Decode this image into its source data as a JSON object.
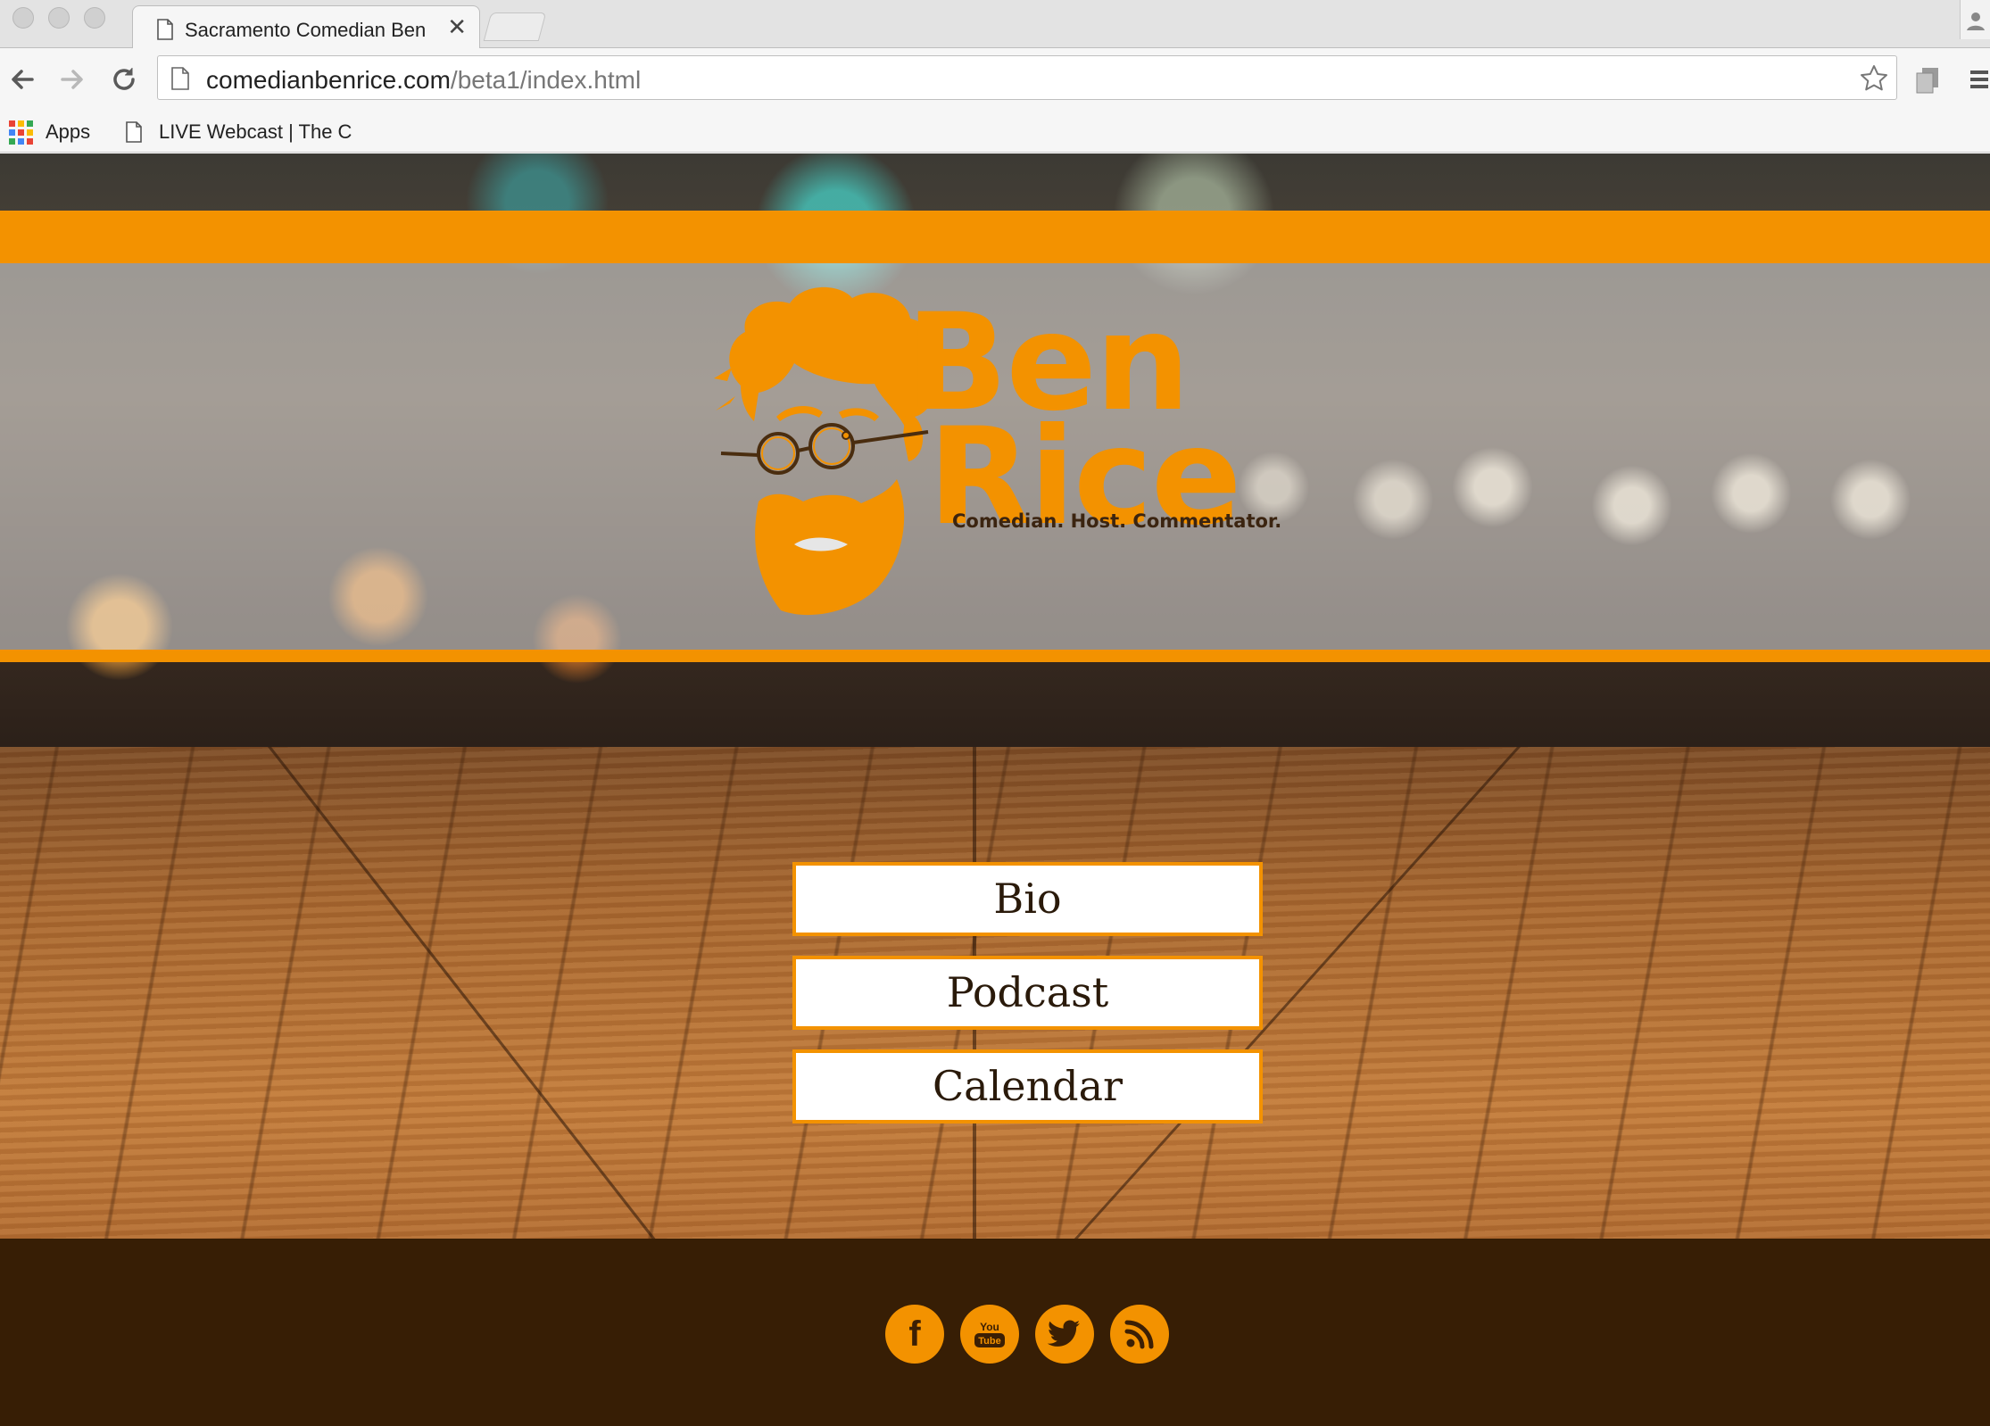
{
  "browser": {
    "tab": {
      "title": "Sacramento Comedian Ben",
      "close": "✕"
    },
    "address_bar": {
      "domain": "comedianbenrice.com",
      "path": "/beta1/index.html"
    },
    "bookmarks": [
      {
        "label": "Apps"
      },
      {
        "label": "LIVE Webcast | The C"
      }
    ]
  },
  "page": {
    "logo": {
      "first_name": "Ben",
      "last_name": "Rice",
      "tagline": "Comedian. Host. Commentator."
    },
    "nav": [
      {
        "label": "Bio"
      },
      {
        "label": "Podcast"
      },
      {
        "label": "Calendar"
      }
    ],
    "social": [
      {
        "icon": "facebook-icon",
        "glyph": "f"
      },
      {
        "icon": "youtube-icon",
        "glyph": "You Tube"
      },
      {
        "icon": "twitter-icon"
      },
      {
        "icon": "rss-icon"
      }
    ]
  },
  "colors": {
    "accent": "#f39200",
    "footer": "#371e05"
  }
}
